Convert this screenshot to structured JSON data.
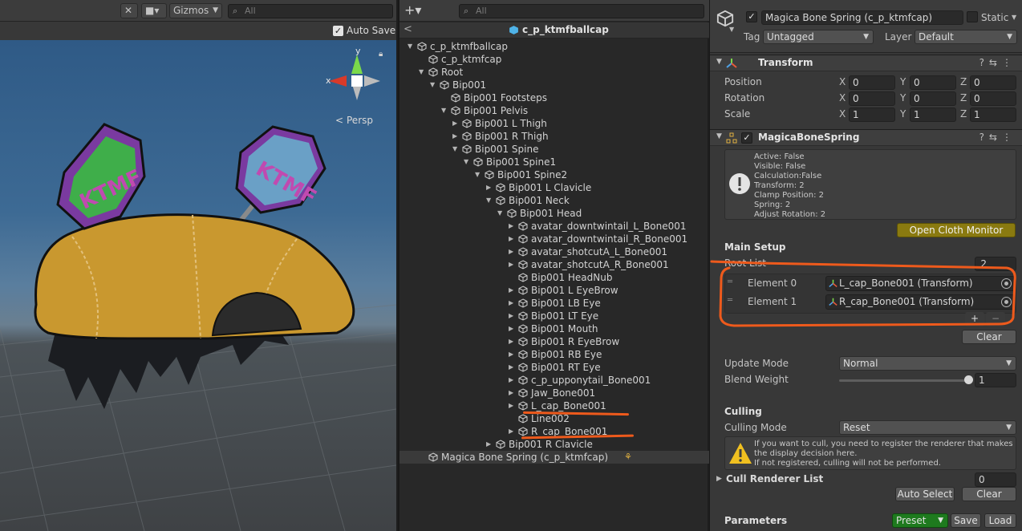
{
  "scene": {
    "gizmos_label": "Gizmos",
    "search_placeholder": "All",
    "auto_save_label": "Auto Save",
    "auto_save_checked": true,
    "axis_y": "y",
    "axis_x": "x",
    "persp_label": "Persp",
    "hat_text_left": "KTMF",
    "hat_text_right": "KTMF"
  },
  "hierarchy": {
    "search_placeholder": "All",
    "prefab_title": "c_p_ktmfballcap",
    "items": [
      {
        "label": "c_p_ktmfballcap",
        "depth": 0,
        "arrow": "down"
      },
      {
        "label": "c_p_ktmfcap",
        "depth": 1,
        "arrow": "none"
      },
      {
        "label": "Root",
        "depth": 1,
        "arrow": "down"
      },
      {
        "label": "Bip001",
        "depth": 2,
        "arrow": "down"
      },
      {
        "label": "Bip001 Footsteps",
        "depth": 3,
        "arrow": "none"
      },
      {
        "label": "Bip001 Pelvis",
        "depth": 3,
        "arrow": "down"
      },
      {
        "label": "Bip001 L Thigh",
        "depth": 4,
        "arrow": "right"
      },
      {
        "label": "Bip001 R Thigh",
        "depth": 4,
        "arrow": "right"
      },
      {
        "label": "Bip001 Spine",
        "depth": 4,
        "arrow": "down"
      },
      {
        "label": "Bip001 Spine1",
        "depth": 5,
        "arrow": "down"
      },
      {
        "label": "Bip001 Spine2",
        "depth": 6,
        "arrow": "down"
      },
      {
        "label": "Bip001 L Clavicle",
        "depth": 7,
        "arrow": "right"
      },
      {
        "label": "Bip001 Neck",
        "depth": 7,
        "arrow": "down"
      },
      {
        "label": "Bip001 Head",
        "depth": 8,
        "arrow": "down"
      },
      {
        "label": "avatar_downtwintail_L_Bone001",
        "depth": 9,
        "arrow": "right"
      },
      {
        "label": "avatar_downtwintail_R_Bone001",
        "depth": 9,
        "arrow": "right"
      },
      {
        "label": "avatar_shotcutA_L_Bone001",
        "depth": 9,
        "arrow": "right"
      },
      {
        "label": "avatar_shotcutA_R_Bone001",
        "depth": 9,
        "arrow": "right"
      },
      {
        "label": "Bip001 HeadNub",
        "depth": 9,
        "arrow": "none"
      },
      {
        "label": "Bip001 L EyeBrow",
        "depth": 9,
        "arrow": "right"
      },
      {
        "label": "Bip001 LB Eye",
        "depth": 9,
        "arrow": "right"
      },
      {
        "label": "Bip001 LT Eye",
        "depth": 9,
        "arrow": "right"
      },
      {
        "label": "Bip001 Mouth",
        "depth": 9,
        "arrow": "right"
      },
      {
        "label": "Bip001 R EyeBrow",
        "depth": 9,
        "arrow": "right"
      },
      {
        "label": "Bip001 RB Eye",
        "depth": 9,
        "arrow": "right"
      },
      {
        "label": "Bip001 RT Eye",
        "depth": 9,
        "arrow": "right"
      },
      {
        "label": "c_p_upponytail_Bone001",
        "depth": 9,
        "arrow": "right"
      },
      {
        "label": "Jaw_Bone001",
        "depth": 9,
        "arrow": "right"
      },
      {
        "label": "L_cap_Bone001",
        "depth": 9,
        "arrow": "right"
      },
      {
        "label": "Line002",
        "depth": 9,
        "arrow": "none"
      },
      {
        "label": "R_cap_Bone001",
        "depth": 9,
        "arrow": "right"
      },
      {
        "label": "Bip001 R Clavicle",
        "depth": 7,
        "arrow": "right"
      },
      {
        "label": "Magica Bone Spring (c_p_ktmfcap)",
        "depth": 1,
        "arrow": "none"
      }
    ]
  },
  "inspector": {
    "object_name": "Magica Bone Spring (c_p_ktmfcap)",
    "static_label": "Static",
    "tag_label": "Tag",
    "tag_value": "Untagged",
    "layer_label": "Layer",
    "layer_value": "Default",
    "transform": {
      "title": "Transform",
      "rows": [
        {
          "label": "Position",
          "x": "0",
          "y": "0",
          "z": "0"
        },
        {
          "label": "Rotation",
          "x": "0",
          "y": "0",
          "z": "0"
        },
        {
          "label": "Scale",
          "x": "1",
          "y": "1",
          "z": "1"
        }
      ]
    },
    "bone_spring": {
      "title": "MagicaBoneSpring",
      "status_lines": [
        "Active: False",
        "Visible: False",
        "Calculation:False",
        "Transform: 2",
        "Clamp Position: 2",
        "Spring: 2",
        "Adjust Rotation: 2"
      ],
      "open_monitor_label": "Open Cloth Monitor",
      "main_setup_label": "Main Setup",
      "root_list_label": "Root List",
      "root_list_count": "2",
      "elements": [
        {
          "label": "Element 0",
          "value": "L_cap_Bone001 (Transform)"
        },
        {
          "label": "Element 1",
          "value": "R_cap_Bone001 (Transform)"
        }
      ],
      "add_label": "+",
      "remove_label": "−",
      "clear_label": "Clear",
      "update_mode_label": "Update Mode",
      "update_mode_value": "Normal",
      "blend_weight_label": "Blend Weight",
      "blend_weight_value": "1",
      "blend_weight_fraction": 1.0,
      "culling_section": "Culling",
      "culling_mode_label": "Culling Mode",
      "culling_mode_value": "Reset",
      "culling_help": [
        "If you want to cull, you need to register the renderer that makes",
        "the display decision here.",
        "If not registered, culling will not be performed."
      ],
      "cull_renderer_label": "Cull Renderer List",
      "cull_renderer_count": "0",
      "auto_select_label": "Auto Select",
      "clear2_label": "Clear",
      "parameters_label": "Parameters",
      "preset_label": "Preset",
      "save_label": "Save",
      "load_label": "Load"
    }
  },
  "colors": {
    "annotation": "#ee5a1c",
    "preset_green": "#1e7a1e",
    "open_monitor_bg": "#8a7a10"
  }
}
